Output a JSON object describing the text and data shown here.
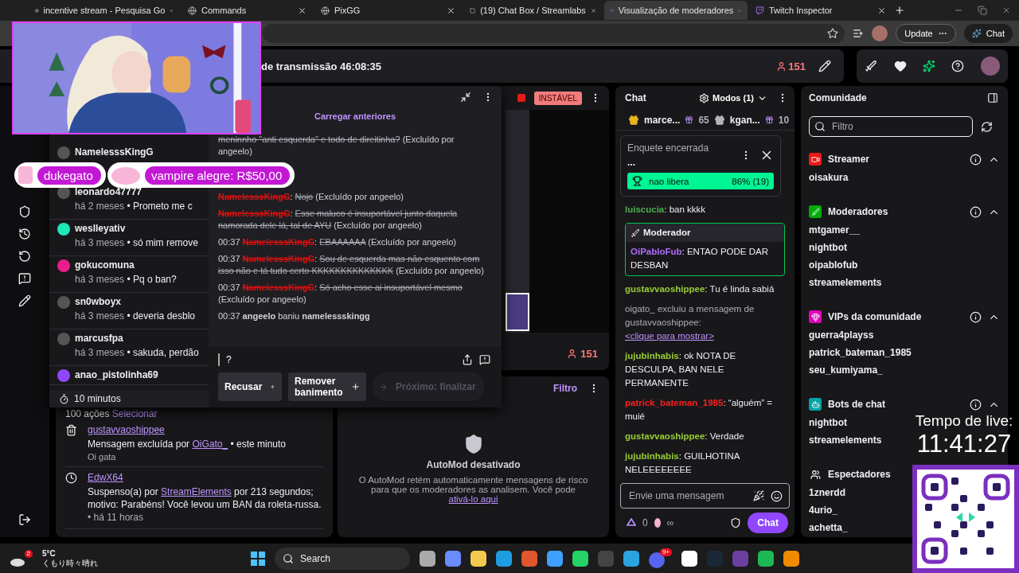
{
  "browser": {
    "tabs": [
      {
        "title": "incentive stream - Pesquisa Go",
        "selected": false
      },
      {
        "title": "Commands",
        "selected": false
      },
      {
        "title": "PixGG",
        "selected": false
      },
      {
        "title": "(19) Chat Box / Streamlabs",
        "selected": false
      },
      {
        "title": "Visualização de moderadores",
        "selected": true
      },
      {
        "title": "Twitch Inspector",
        "selected": false
      }
    ],
    "update_button": "Update",
    "chat_button": "Chat"
  },
  "header": {
    "title": "de transmissão 46:08:35",
    "viewers": "151"
  },
  "alerts": [
    {
      "text": "dukegato"
    },
    {
      "text": "vampire alegre: R$50,00"
    }
  ],
  "user_card": {
    "load_more": "Carregar anteriores",
    "users": [
      {
        "name": "NamelesssKingG"
      },
      {
        "name": "leonardo47777",
        "when": "há 2 meses",
        "text": "Prometo me c"
      },
      {
        "name": "weslleyativ",
        "when": "há 3 meses",
        "text": "só mim remove",
        "color": "#1de9b6"
      },
      {
        "name": "gokucomuna",
        "when": "há 3 meses",
        "text": "Pq o ban?",
        "color": "#e91e8c"
      },
      {
        "name": "sn0wboyx",
        "when": "há 3 meses",
        "text": "deveria desblo"
      },
      {
        "name": "marcusfpa",
        "when": "há 3 meses",
        "text": "sakuda, perdão"
      },
      {
        "name": "anao_pistolinha69",
        "color": "#9146ff"
      }
    ],
    "timer": "10 minutos",
    "log": [
      {
        "kind": "deleted",
        "text": "meninnho \"anti esquerda\" e todo de direitinha?",
        "note": "(Excluído por angeelo)"
      },
      {
        "kind": "deleted",
        "user": "NamelesssKingG",
        "text": "Nojo",
        "note": "(Excluído por angeelo)"
      },
      {
        "kind": "deleted",
        "user": "NamelesssKingG",
        "text": "Esse maluco é insuportável junto daquela namorada dele lá, tal de AYU",
        "note": "(Excluído por angeelo)"
      },
      {
        "kind": "deleted",
        "time": "00:37",
        "user": "NamelesssKingG",
        "text": "EBAAAAAA",
        "note": "(Excluído por angeelo)"
      },
      {
        "kind": "deleted",
        "time": "00:37",
        "user": "NamelesssKingG",
        "text": "Sou de esquerda mas não esquento com isso não e tá tudo certo KKKKKKKKKKKKKK",
        "note": "(Excluído por angeelo)"
      },
      {
        "kind": "deleted",
        "time": "00:37",
        "user": "NamelesssKingG",
        "text": "Só acho esse ai insuportável mesmo",
        "note": "(Excluído por angeelo)"
      },
      {
        "kind": "ban",
        "time": "00:37",
        "actor": "angeelo",
        "action": "baniu",
        "target": "namelessskingg"
      }
    ],
    "separator": ":",
    "bullet": "•",
    "reply_value": "?",
    "actions": [
      {
        "label": "Recusar",
        "disabled": false
      },
      {
        "label": "Remover banimento",
        "disabled": false
      },
      {
        "label": "Próximo: finalizar",
        "disabled": true
      }
    ]
  },
  "preview": {
    "status": "INSTÁVEL",
    "viewers": "151"
  },
  "mod_actions": {
    "count": "100 ações",
    "select": "Selecionar",
    "items": [
      {
        "kind": "delete",
        "user": "gustavvaoshippee",
        "pre": "Mensagem excluída por",
        "by": "OiGato_",
        "post": "• este minuto",
        "detail": "Oi gata"
      },
      {
        "kind": "timeout",
        "user": "EdwX64",
        "pre": "Suspenso(a) por",
        "by": "StreamElements",
        "post": "por 213 segundos; motivo: Parabéns! Você levou um BAN da roleta-russa.",
        "when": "• há 11 horas"
      }
    ]
  },
  "automod": {
    "filter": "Filtro",
    "title": "AutoMod desativado",
    "text": "O AutoMod retém automaticamente mensagens de risco para que os moderadores as analisem. Você pode",
    "link": "ativá-lo aqui"
  },
  "chat": {
    "title": "Chat",
    "modes": "Modos (1)",
    "leaders": [
      {
        "name": "marce...",
        "gifts": "65",
        "color": "#e6b422"
      },
      {
        "name": "kgan...",
        "gifts": "10",
        "color": "#b0b6c0"
      }
    ],
    "poll": {
      "title": "Enquete encerrada",
      "question": "...",
      "option": "nao libera",
      "result": "86% (19)"
    },
    "messages": [
      {
        "kind": "message",
        "user": "luiscucia",
        "color": "#4caf50",
        "text": "ban kkkk"
      },
      {
        "kind": "highlight",
        "label": "Moderador",
        "user": "OiPabloFub",
        "color": "#b16cff",
        "text": "ENTAO PODE DAR DESBAN"
      },
      {
        "kind": "message",
        "user": "gustavvaoshippee",
        "color": "#9acd32",
        "text": "Tu é linda sabiá"
      },
      {
        "kind": "system",
        "text": "oigato_ excluiu a mensagem de gustavvaoshippee:",
        "link": "<clique para mostrar>"
      },
      {
        "kind": "message",
        "user": "jujubinhabis",
        "color": "#9acd32",
        "text": "ok NOTA DE DESCULPA, BAN NELE PERMANENTE"
      },
      {
        "kind": "message",
        "user": "patrick_bateman_1985",
        "color": "#ff1e1e",
        "text": "“alguém” = muié"
      },
      {
        "kind": "message",
        "user": "gustavvaoshippee",
        "color": "#9acd32",
        "text": "Verdade"
      },
      {
        "kind": "message",
        "user": "jujubinhabis",
        "color": "#9acd32",
        "text": "GUILHOTINA NELEEEEEEEE"
      }
    ],
    "separator": ":",
    "placeholder": "Envie uma mensagem",
    "points": "0",
    "infinity": "∞",
    "send": "Chat"
  },
  "community": {
    "title": "Comunidade",
    "placeholder": "Filtro",
    "sections": [
      {
        "title": "Streamer",
        "color": "#e91916",
        "users": [
          "oisakura"
        ]
      },
      {
        "title": "Moderadores",
        "color": "#00ad03",
        "users": [
          "mtgamer__",
          "nightbot",
          "oipablofub",
          "streamelements"
        ]
      },
      {
        "title": "VIPs da comunidade",
        "color": "#e005b9",
        "users": [
          "guerra4playss",
          "patrick_bateman_1985",
          "seu_kumiyama_"
        ]
      },
      {
        "title": "Bots de chat",
        "color": "#00a3a3",
        "users": [
          "nightbot",
          "streamelements"
        ]
      },
      {
        "title": "Espectadores",
        "users": [
          "1znerdd",
          "4urio_",
          "achetta_"
        ]
      }
    ]
  },
  "overlay": {
    "label": "Tempo de live:",
    "time": "11:41:27"
  },
  "taskbar": {
    "temp": "5°C",
    "weather": "くもり時々晴れ",
    "weather_badge": "2",
    "search": "Search",
    "discord_badge": "9+"
  }
}
